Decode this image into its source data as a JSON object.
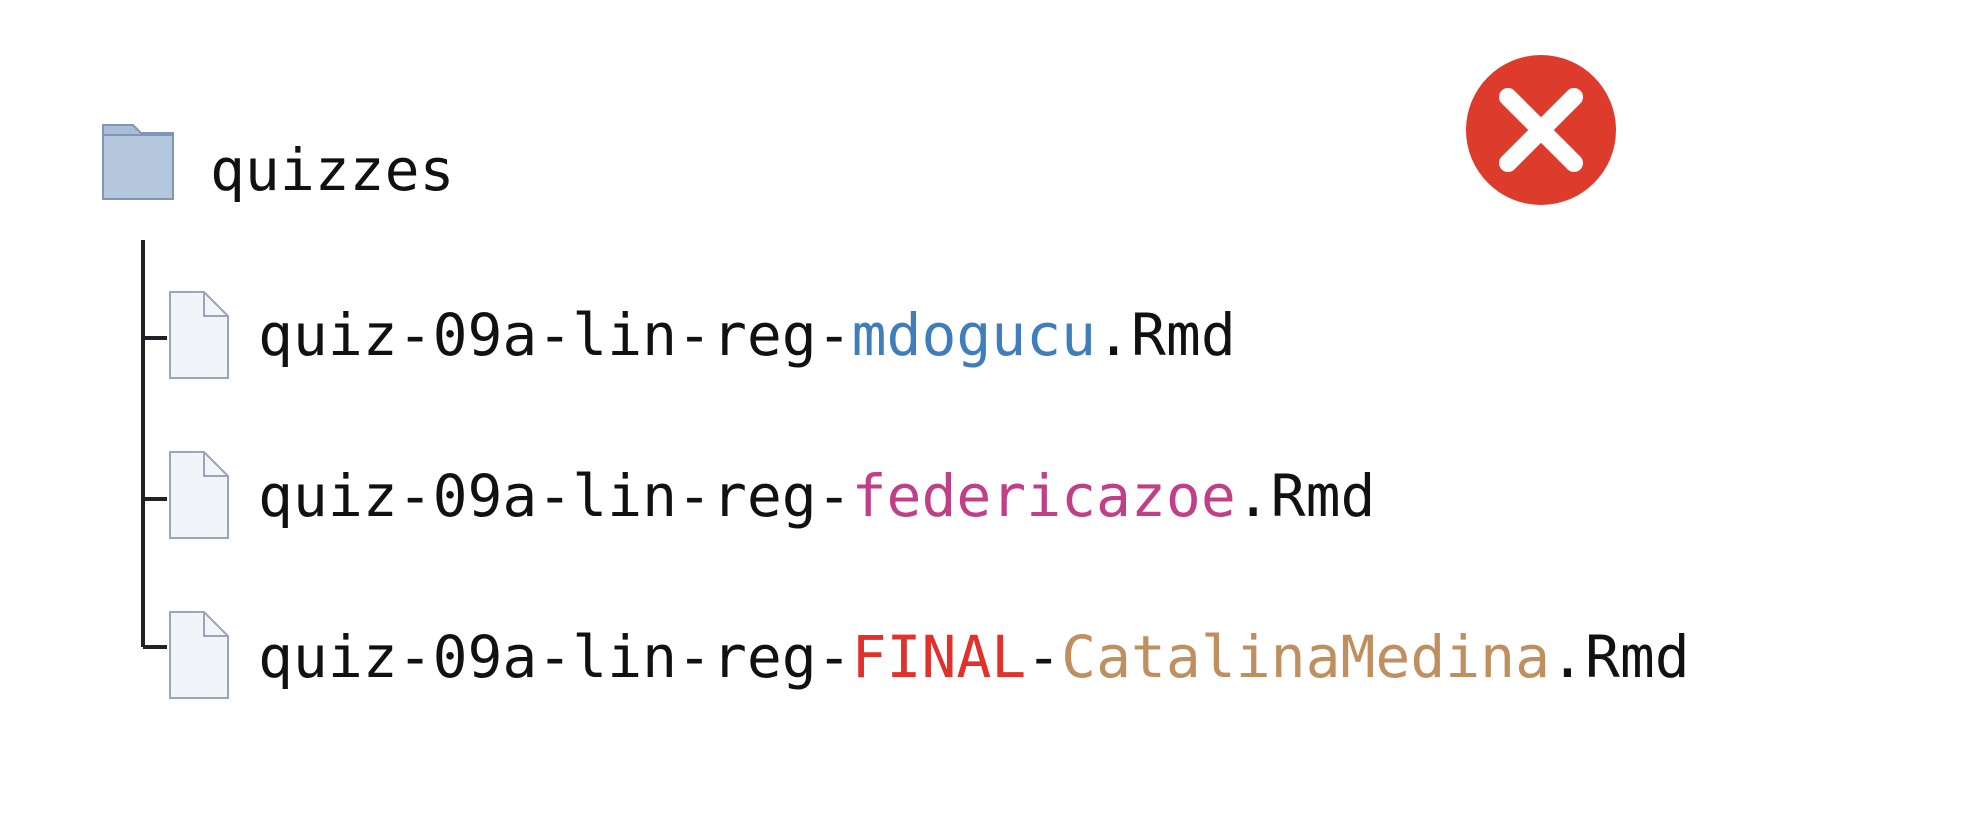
{
  "colors": {
    "text": "#111111",
    "folder_fill": "#a9bdd6",
    "folder_edge": "#7f96b6",
    "file_fill": "#f1f4f8",
    "file_edge": "#98a6b8",
    "tree_line": "#1f2328",
    "badge_red": "#dd3c2c",
    "badge_x": "#ffffff",
    "blue": "#3f7dbc",
    "magenta": "#c03f86",
    "red": "#e2302b",
    "tan": "#bf8f5f"
  },
  "tree": {
    "folder": {
      "name": "quizzes",
      "icon": "folder-icon"
    },
    "files": [
      {
        "icon": "file-icon",
        "parts": [
          {
            "text": "quiz-09a-lin-reg-",
            "color": "#111111"
          },
          {
            "text": "mdogucu",
            "color": "#3f7dbc"
          },
          {
            "text": ".Rmd",
            "color": "#111111"
          }
        ]
      },
      {
        "icon": "file-icon",
        "parts": [
          {
            "text": "quiz-09a-lin-reg-",
            "color": "#111111"
          },
          {
            "text": "federicazoe",
            "color": "#c03f86"
          },
          {
            "text": ".Rmd",
            "color": "#111111"
          }
        ]
      },
      {
        "icon": "file-icon",
        "parts": [
          {
            "text": "quiz-09a-lin-reg-",
            "color": "#111111"
          },
          {
            "text": "FINAL",
            "color": "#e2302b"
          },
          {
            "text": "-",
            "color": "#111111"
          },
          {
            "text": "CatalinaMedina",
            "color": "#bf8f5f"
          },
          {
            "text": ".Rmd",
            "color": "#111111"
          }
        ]
      }
    ]
  },
  "status": {
    "icon": "error-x-icon",
    "color": "#dd3c2c"
  }
}
